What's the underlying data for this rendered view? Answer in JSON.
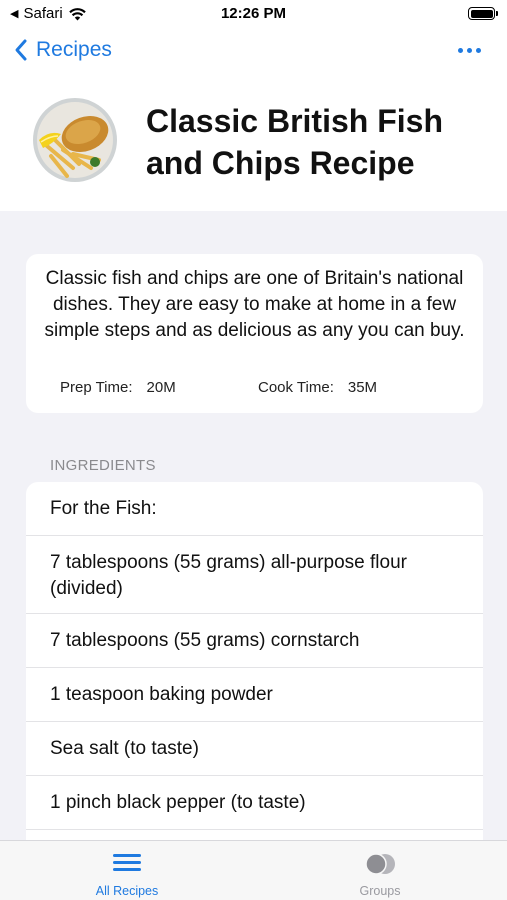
{
  "status_bar": {
    "back_app": "Safari",
    "time": "12:26 PM"
  },
  "nav": {
    "back_label": "Recipes",
    "more_icon": "ellipsis-icon"
  },
  "recipe": {
    "title": "Classic British Fish and Chips Recipe",
    "description": "Classic fish and chips are one of Britain's national dishes. They are easy to make at home in a few simple steps and as delicious as any you can buy.",
    "prep_label": "Prep Time:",
    "prep_value": "20M",
    "cook_label": "Cook Time:",
    "cook_value": "35M"
  },
  "ingredients": {
    "section_label": "INGREDIENTS",
    "items": [
      "For the Fish:",
      "7 tablespoons (55 grams) all-purpose flour (divided)",
      "7 tablespoons (55 grams) cornstarch",
      "1 teaspoon baking powder",
      "Sea salt (to taste)",
      "1 pinch black pepper (to taste)",
      ""
    ]
  },
  "tab_bar": {
    "tabs": [
      {
        "label": "All Recipes",
        "icon": "list-icon",
        "selected": true
      },
      {
        "label": "Groups",
        "icon": "circles-icon",
        "selected": false
      }
    ]
  },
  "colors": {
    "accent": "#1f7ae0",
    "background": "#f2f2f7",
    "inactive_tab": "#9a9aa0"
  }
}
